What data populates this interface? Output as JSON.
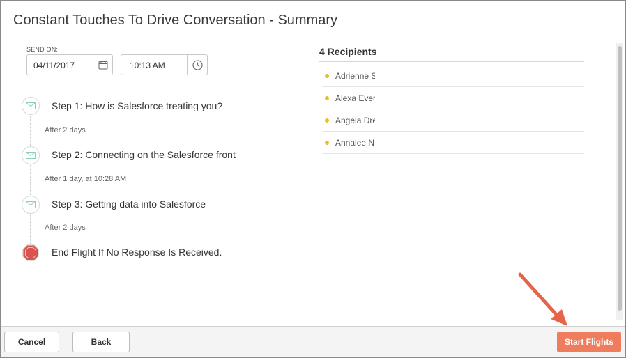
{
  "dialog": {
    "title": "Constant Touches To Drive Conversation - Summary"
  },
  "send_on": {
    "label": "SEND ON:",
    "date": "04/11/2017",
    "time": "10:13 AM"
  },
  "steps": [
    {
      "label": "Step 1: How is Salesforce treating you?",
      "icon": "envelope-icon"
    },
    {
      "label": "Step 2: Connecting on the Salesforce front",
      "icon": "envelope-icon"
    },
    {
      "label": "Step 3: Getting data into Salesforce",
      "icon": "envelope-icon"
    }
  ],
  "delays": [
    "After 2 days",
    "After 1 day, at 10:28 AM",
    "After 2 days"
  ],
  "end_step": {
    "label": "End Flight If No Response Is Received.",
    "icon": "stop-sign-icon"
  },
  "recipients": {
    "title": "4 Recipients",
    "items": [
      "Adrienne S",
      "Alexa Ever",
      "Angela Dre",
      "Annalee N"
    ],
    "dot_color": "#e6c02a"
  },
  "footer": {
    "cancel": "Cancel",
    "back": "Back",
    "start": "Start Flights"
  },
  "colors": {
    "primary_button": "#ef7d5d",
    "annotation_arrow": "#e5644a",
    "stop_sign": "#d9534f"
  }
}
